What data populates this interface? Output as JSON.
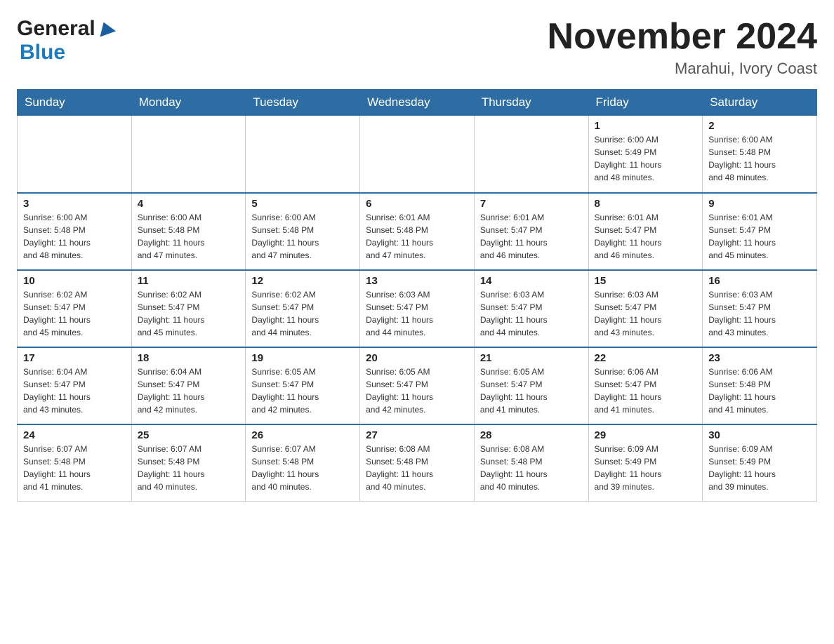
{
  "header": {
    "logo_general": "General",
    "logo_blue": "Blue",
    "month_title": "November 2024",
    "location": "Marahui, Ivory Coast"
  },
  "days_of_week": [
    "Sunday",
    "Monday",
    "Tuesday",
    "Wednesday",
    "Thursday",
    "Friday",
    "Saturday"
  ],
  "weeks": [
    [
      {
        "day": "",
        "info": ""
      },
      {
        "day": "",
        "info": ""
      },
      {
        "day": "",
        "info": ""
      },
      {
        "day": "",
        "info": ""
      },
      {
        "day": "",
        "info": ""
      },
      {
        "day": "1",
        "info": "Sunrise: 6:00 AM\nSunset: 5:49 PM\nDaylight: 11 hours\nand 48 minutes."
      },
      {
        "day": "2",
        "info": "Sunrise: 6:00 AM\nSunset: 5:48 PM\nDaylight: 11 hours\nand 48 minutes."
      }
    ],
    [
      {
        "day": "3",
        "info": "Sunrise: 6:00 AM\nSunset: 5:48 PM\nDaylight: 11 hours\nand 48 minutes."
      },
      {
        "day": "4",
        "info": "Sunrise: 6:00 AM\nSunset: 5:48 PM\nDaylight: 11 hours\nand 47 minutes."
      },
      {
        "day": "5",
        "info": "Sunrise: 6:00 AM\nSunset: 5:48 PM\nDaylight: 11 hours\nand 47 minutes."
      },
      {
        "day": "6",
        "info": "Sunrise: 6:01 AM\nSunset: 5:48 PM\nDaylight: 11 hours\nand 47 minutes."
      },
      {
        "day": "7",
        "info": "Sunrise: 6:01 AM\nSunset: 5:47 PM\nDaylight: 11 hours\nand 46 minutes."
      },
      {
        "day": "8",
        "info": "Sunrise: 6:01 AM\nSunset: 5:47 PM\nDaylight: 11 hours\nand 46 minutes."
      },
      {
        "day": "9",
        "info": "Sunrise: 6:01 AM\nSunset: 5:47 PM\nDaylight: 11 hours\nand 45 minutes."
      }
    ],
    [
      {
        "day": "10",
        "info": "Sunrise: 6:02 AM\nSunset: 5:47 PM\nDaylight: 11 hours\nand 45 minutes."
      },
      {
        "day": "11",
        "info": "Sunrise: 6:02 AM\nSunset: 5:47 PM\nDaylight: 11 hours\nand 45 minutes."
      },
      {
        "day": "12",
        "info": "Sunrise: 6:02 AM\nSunset: 5:47 PM\nDaylight: 11 hours\nand 44 minutes."
      },
      {
        "day": "13",
        "info": "Sunrise: 6:03 AM\nSunset: 5:47 PM\nDaylight: 11 hours\nand 44 minutes."
      },
      {
        "day": "14",
        "info": "Sunrise: 6:03 AM\nSunset: 5:47 PM\nDaylight: 11 hours\nand 44 minutes."
      },
      {
        "day": "15",
        "info": "Sunrise: 6:03 AM\nSunset: 5:47 PM\nDaylight: 11 hours\nand 43 minutes."
      },
      {
        "day": "16",
        "info": "Sunrise: 6:03 AM\nSunset: 5:47 PM\nDaylight: 11 hours\nand 43 minutes."
      }
    ],
    [
      {
        "day": "17",
        "info": "Sunrise: 6:04 AM\nSunset: 5:47 PM\nDaylight: 11 hours\nand 43 minutes."
      },
      {
        "day": "18",
        "info": "Sunrise: 6:04 AM\nSunset: 5:47 PM\nDaylight: 11 hours\nand 42 minutes."
      },
      {
        "day": "19",
        "info": "Sunrise: 6:05 AM\nSunset: 5:47 PM\nDaylight: 11 hours\nand 42 minutes."
      },
      {
        "day": "20",
        "info": "Sunrise: 6:05 AM\nSunset: 5:47 PM\nDaylight: 11 hours\nand 42 minutes."
      },
      {
        "day": "21",
        "info": "Sunrise: 6:05 AM\nSunset: 5:47 PM\nDaylight: 11 hours\nand 41 minutes."
      },
      {
        "day": "22",
        "info": "Sunrise: 6:06 AM\nSunset: 5:47 PM\nDaylight: 11 hours\nand 41 minutes."
      },
      {
        "day": "23",
        "info": "Sunrise: 6:06 AM\nSunset: 5:48 PM\nDaylight: 11 hours\nand 41 minutes."
      }
    ],
    [
      {
        "day": "24",
        "info": "Sunrise: 6:07 AM\nSunset: 5:48 PM\nDaylight: 11 hours\nand 41 minutes."
      },
      {
        "day": "25",
        "info": "Sunrise: 6:07 AM\nSunset: 5:48 PM\nDaylight: 11 hours\nand 40 minutes."
      },
      {
        "day": "26",
        "info": "Sunrise: 6:07 AM\nSunset: 5:48 PM\nDaylight: 11 hours\nand 40 minutes."
      },
      {
        "day": "27",
        "info": "Sunrise: 6:08 AM\nSunset: 5:48 PM\nDaylight: 11 hours\nand 40 minutes."
      },
      {
        "day": "28",
        "info": "Sunrise: 6:08 AM\nSunset: 5:48 PM\nDaylight: 11 hours\nand 40 minutes."
      },
      {
        "day": "29",
        "info": "Sunrise: 6:09 AM\nSunset: 5:49 PM\nDaylight: 11 hours\nand 39 minutes."
      },
      {
        "day": "30",
        "info": "Sunrise: 6:09 AM\nSunset: 5:49 PM\nDaylight: 11 hours\nand 39 minutes."
      }
    ]
  ]
}
